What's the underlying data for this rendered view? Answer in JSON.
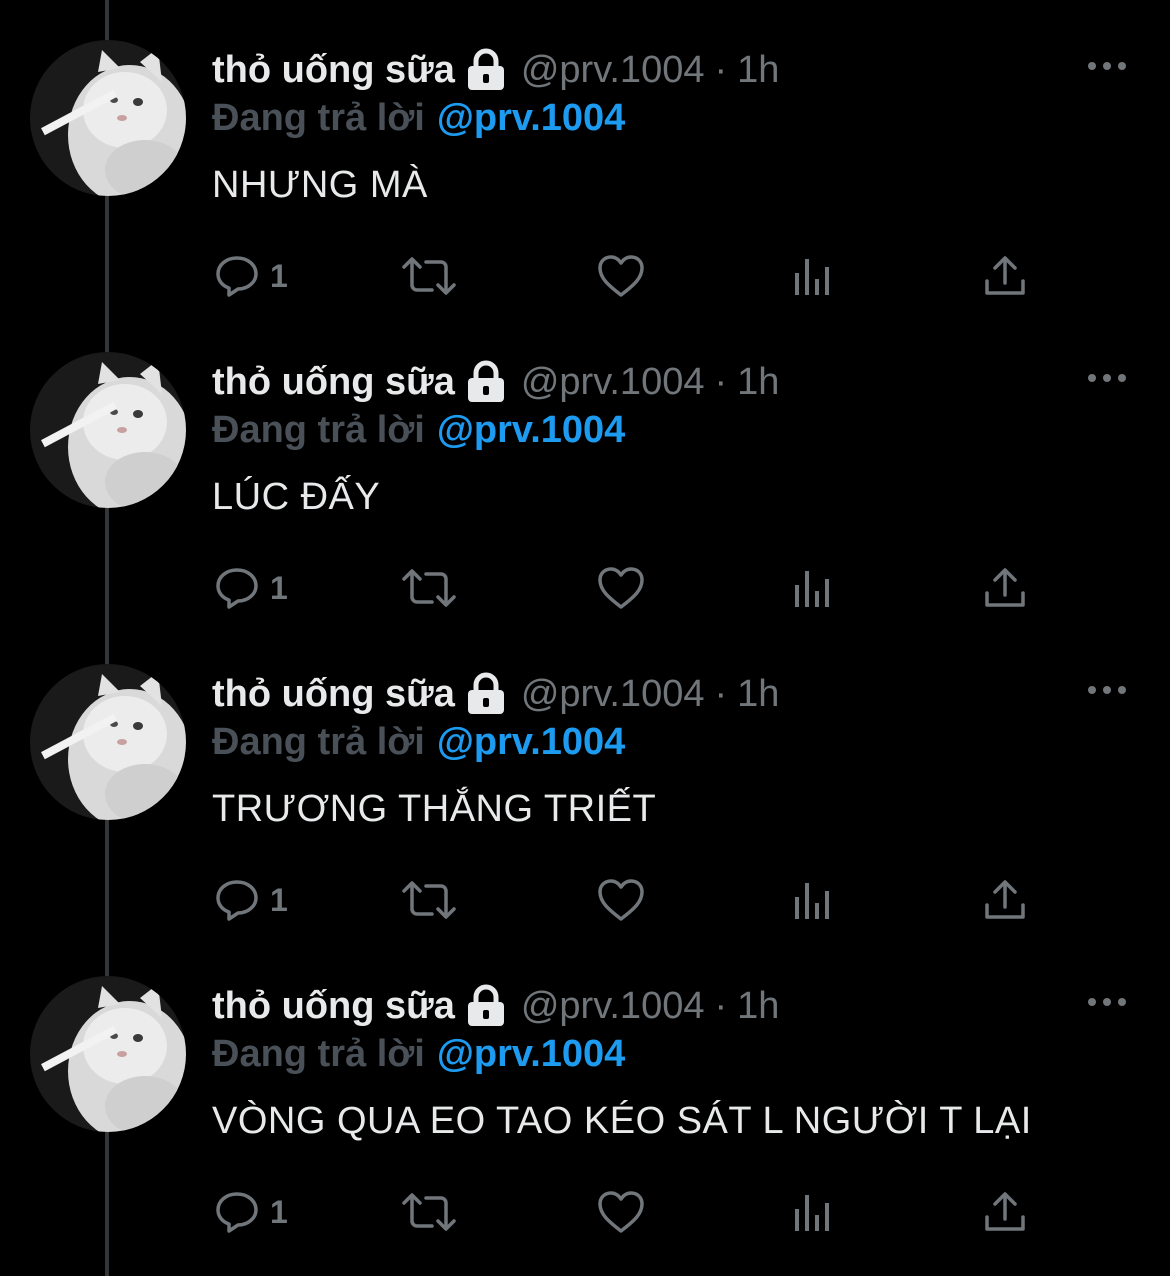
{
  "theme": {
    "background": "#000000",
    "text_primary": "#e7e9ea",
    "text_secondary": "#71767b",
    "accent": "#1d9bf0",
    "thread_line": "#333639"
  },
  "tweets": [
    {
      "display_name": "thỏ uống sữa",
      "handle": "@prv.1004",
      "separator": "·",
      "time": "1h",
      "reply_prefix": "Đang trả lời",
      "reply_to": "@prv.1004",
      "text": "NHƯNG MÀ",
      "reply_count": "1",
      "icons": [
        "lock-icon",
        "more-icon",
        "reply-icon",
        "retweet-icon",
        "like-icon",
        "views-icon",
        "share-icon"
      ]
    },
    {
      "display_name": "thỏ uống sữa",
      "handle": "@prv.1004",
      "separator": "·",
      "time": "1h",
      "reply_prefix": "Đang trả lời",
      "reply_to": "@prv.1004",
      "text": "LÚC ĐẤY",
      "reply_count": "1",
      "icons": [
        "lock-icon",
        "more-icon",
        "reply-icon",
        "retweet-icon",
        "like-icon",
        "views-icon",
        "share-icon"
      ]
    },
    {
      "display_name": "thỏ uống sữa",
      "handle": "@prv.1004",
      "separator": "·",
      "time": "1h",
      "reply_prefix": "Đang trả lời",
      "reply_to": "@prv.1004",
      "text": "TRƯƠNG THẮNG TRIẾT",
      "reply_count": "1",
      "icons": [
        "lock-icon",
        "more-icon",
        "reply-icon",
        "retweet-icon",
        "like-icon",
        "views-icon",
        "share-icon"
      ]
    },
    {
      "display_name": "thỏ uống sữa",
      "handle": "@prv.1004",
      "separator": "·",
      "time": "1h",
      "reply_prefix": "Đang trả lời",
      "reply_to": "@prv.1004",
      "text": "VÒNG QUA EO TAO KÉO SÁT L NGƯỜI T LẠI",
      "reply_count": "1",
      "icons": [
        "lock-icon",
        "more-icon",
        "reply-icon",
        "retweet-icon",
        "like-icon",
        "views-icon",
        "share-icon"
      ]
    }
  ]
}
